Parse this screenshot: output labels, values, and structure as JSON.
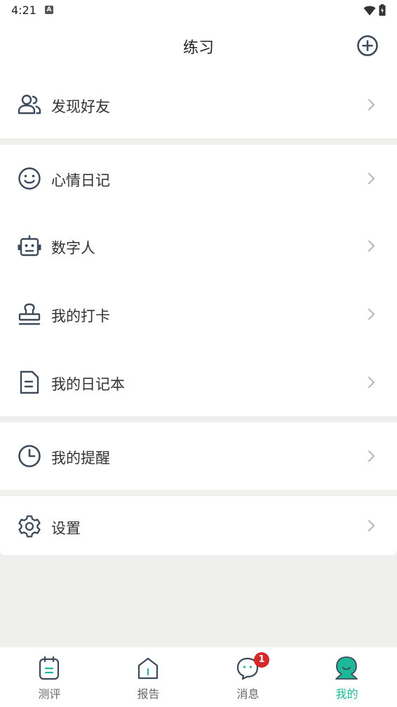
{
  "status_bar": {
    "time": "4:21",
    "notification_icon_letter": "A"
  },
  "header": {
    "title": "练习",
    "add_icon": "plus-circle-icon"
  },
  "sections": [
    {
      "items": [
        {
          "label": "发现好友",
          "icon": "friends-icon"
        }
      ]
    },
    {
      "items": [
        {
          "label": "心情日记",
          "icon": "smile-icon"
        },
        {
          "label": "数字人",
          "icon": "robot-icon"
        },
        {
          "label": "我的打卡",
          "icon": "stamp-icon"
        },
        {
          "label": "我的日记本",
          "icon": "document-icon"
        }
      ]
    },
    {
      "items": [
        {
          "label": "我的提醒",
          "icon": "clock-icon"
        }
      ]
    },
    {
      "items": [
        {
          "label": "设置",
          "icon": "gear-icon"
        }
      ]
    }
  ],
  "tabbar": {
    "tabs": [
      {
        "label": "测评",
        "icon": "notebook-icon",
        "active": false
      },
      {
        "label": "报告",
        "icon": "report-icon",
        "active": false
      },
      {
        "label": "消息",
        "icon": "chat-bubble-icon",
        "active": false,
        "badge": "1"
      },
      {
        "label": "我的",
        "icon": "avatar-icon",
        "active": true
      }
    ]
  },
  "colors": {
    "accent": "#1fb79a",
    "badge": "#d62828",
    "icon_stroke": "#3d4a5a",
    "background": "#eff0ee"
  }
}
